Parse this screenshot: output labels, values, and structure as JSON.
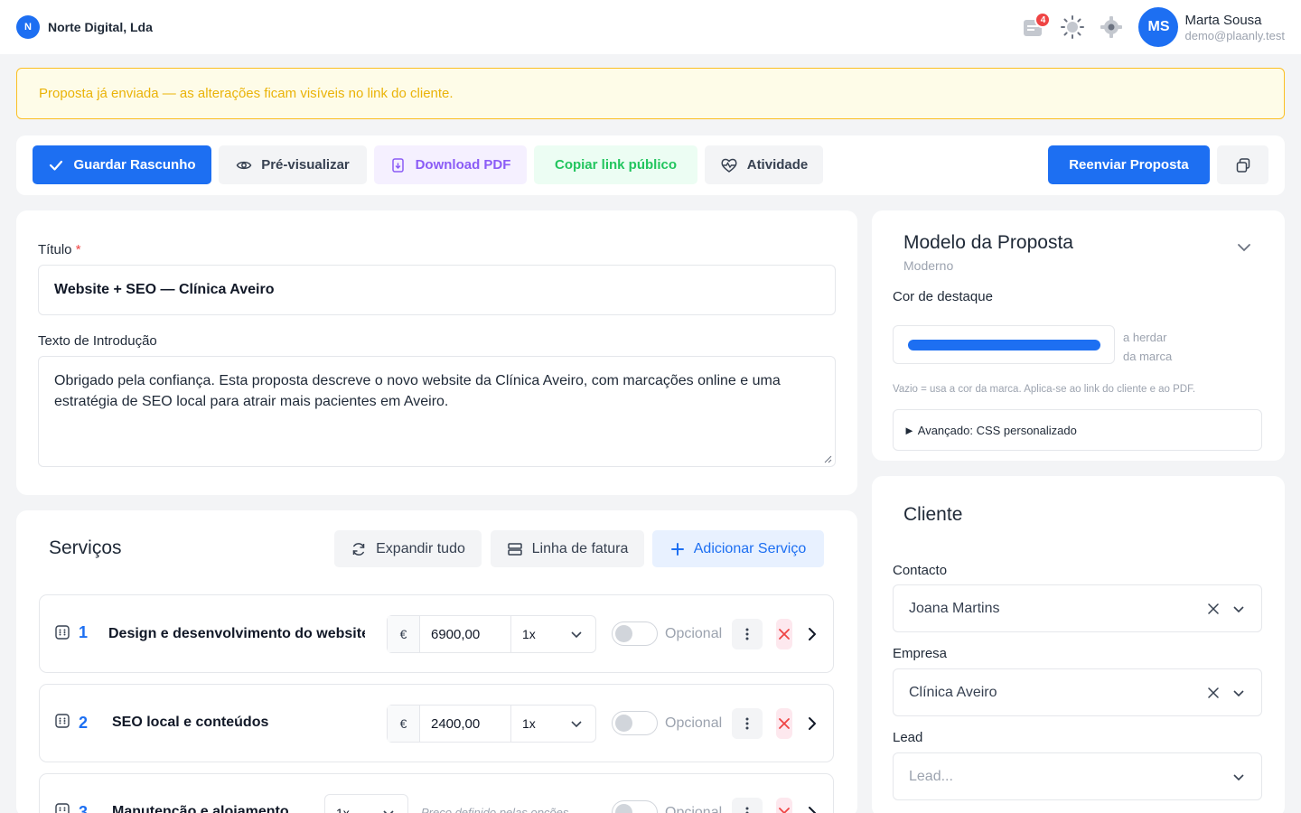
{
  "org": {
    "initial": "N",
    "name": "Norte Digital, Lda"
  },
  "user": {
    "initials": "MS",
    "name": "Marta Sousa",
    "email": "demo@plaanly.test",
    "notifications": "4"
  },
  "banner": {
    "text": "Proposta já enviada — as alterações ficam visíveis no link do cliente."
  },
  "toolbar": {
    "save": "Guardar Rascunho",
    "preview": "Pré-visualizar",
    "download": "Download PDF",
    "copy_link": "Copiar link público",
    "activity": "Atividade",
    "resend": "Reenviar Proposta"
  },
  "form": {
    "title_label": "Título",
    "required_mark": "*",
    "title_value": "Website + SEO — Clínica Aveiro",
    "intro_label": "Texto de Introdução",
    "intro_value": "Obrigado pela confiança. Esta proposta descreve o novo website da Clínica Aveiro, com marcações online e uma estratégia de SEO local para atrair mais pacientes em Aveiro."
  },
  "template": {
    "heading": "Modelo da Proposta",
    "subtitle": "Moderno",
    "accent_label": "Cor de destaque",
    "accent_color": "#1d6ff2",
    "inherit_line1": "a herdar",
    "inherit_line2": "da marca",
    "hint": "Vazio = usa a cor da marca. Aplica-se ao link do cliente e ao PDF.",
    "advanced": "► Avançado: CSS personalizado"
  },
  "services": {
    "heading": "Serviços",
    "expand_all": "Expandir tudo",
    "invoice_line": "Linha de fatura",
    "add_service": "Adicionar Serviço",
    "optional_label": "Opcional",
    "items": [
      {
        "num": "1",
        "title": "Design e desenvolvimento do website",
        "currency": "€",
        "price": "6900,00",
        "qty": "1x"
      },
      {
        "num": "2",
        "title": "SEO local e conteúdos",
        "currency": "€",
        "price": "2400,00",
        "qty": "1x"
      },
      {
        "num": "3",
        "title": "Manutenção e alojamento",
        "qty": "1x",
        "price_placeholder": "Preço definido pelas opções"
      }
    ]
  },
  "client": {
    "heading": "Cliente",
    "contact_label": "Contacto",
    "contact_value": "Joana Martins",
    "company_label": "Empresa",
    "company_value": "Clínica Aveiro",
    "lead_label": "Lead",
    "lead_placeholder": "Lead..."
  }
}
